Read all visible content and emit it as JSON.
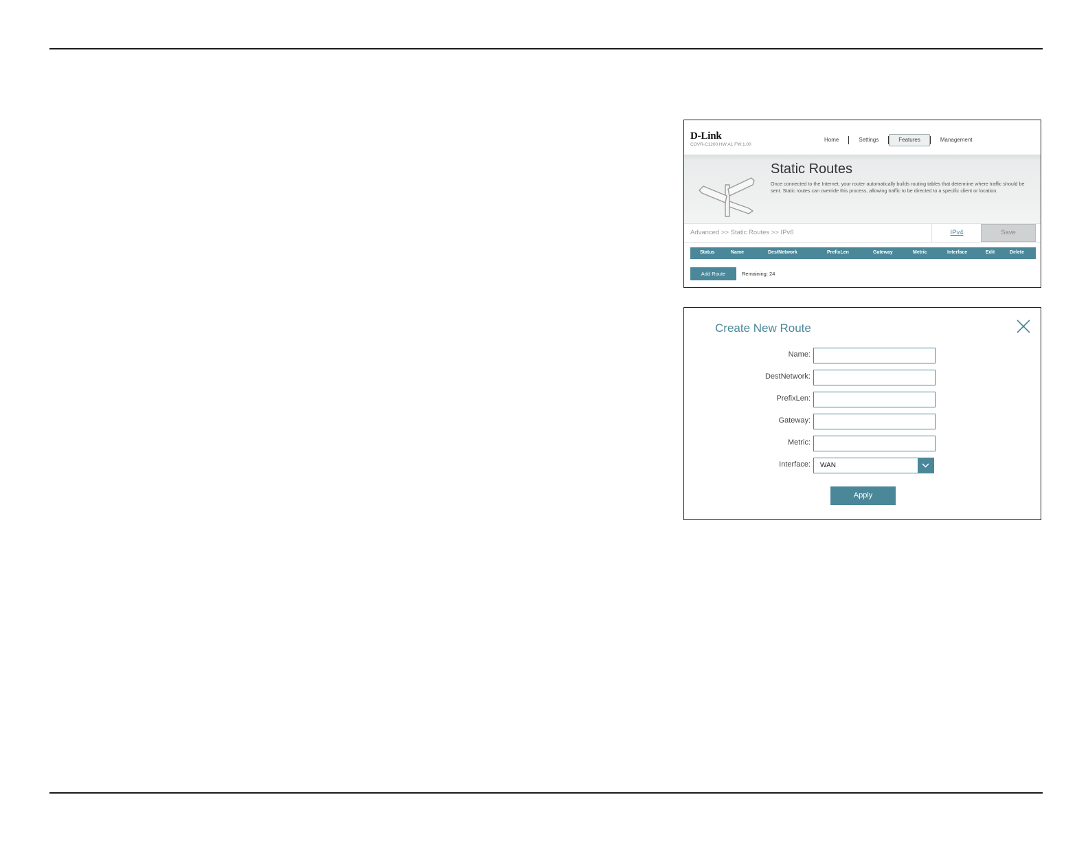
{
  "static_routes": {
    "brand": {
      "logo": "D-Link",
      "model": "COVR-C1200 HW:A1 FW:1.00"
    },
    "nav": {
      "home": "Home",
      "settings": "Settings",
      "features": "Features",
      "management": "Management"
    },
    "banner": {
      "title": "Static Routes",
      "description": "Once connected to the Internet, your router automatically builds routing tables that determine where traffic should be sent. Static routes can override this process, allowing traffic to be directed to a specific client or location."
    },
    "breadcrumb": "Advanced >> Static Routes >> IPv6",
    "ipv4_link": "IPv4",
    "save_label": "Save",
    "table_headers": [
      "Status",
      "Name",
      "DestNetwork",
      "PrefixLen",
      "Gateway",
      "Metric",
      "Interface",
      "Edit",
      "Delete"
    ],
    "add_route_label": "Add Route",
    "remaining": "Remaining: 24"
  },
  "create_route": {
    "title": "Create New Route",
    "fields": {
      "name": {
        "label": "Name:",
        "value": ""
      },
      "dest_network": {
        "label": "DestNetwork:",
        "value": ""
      },
      "prefix_len": {
        "label": "PrefixLen:",
        "value": ""
      },
      "gateway": {
        "label": "Gateway:",
        "value": ""
      },
      "metric": {
        "label": "Metric:",
        "value": ""
      },
      "interface": {
        "label": "Interface:",
        "value": "WAN"
      }
    },
    "apply_label": "Apply"
  },
  "colors": {
    "accent": "#4a8799",
    "rule": "#1a1a1a",
    "save_disabled": "#cfd2d2"
  }
}
